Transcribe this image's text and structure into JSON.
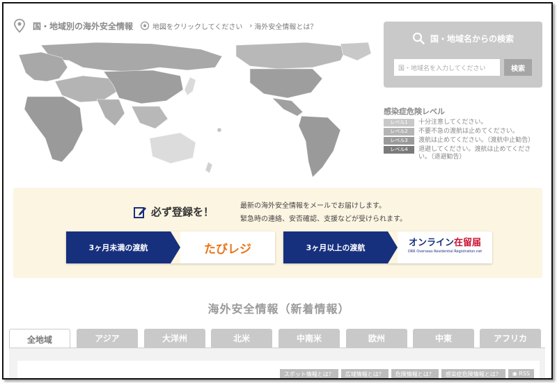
{
  "header": {
    "title": "国・地域別の海外安全情報",
    "hint": "地図をクリックしてください",
    "about_link": "海外安全情報とは？"
  },
  "search": {
    "title": "国・地域名からの検索",
    "placeholder": "国・地域名を入力してください",
    "button": "検索"
  },
  "legend": {
    "title": "感染症危険レベル",
    "levels": [
      {
        "badge": "レベル1",
        "text": "十分注意してください。",
        "color": "#c8c8c8"
      },
      {
        "badge": "レベル2",
        "text": "不要不急の渡航は止めてください。",
        "color": "#b4b4b4"
      },
      {
        "badge": "レベル3",
        "text": "渡航は止めてください。（渡航中止勧告）",
        "color": "#9a9a9a"
      },
      {
        "badge": "レベル4",
        "text": "退避してください。渡航は止めてください。（退避勧告）",
        "color": "#7a7a7a"
      }
    ]
  },
  "register": {
    "heading": "必ず登録を！",
    "desc_line1": "最新の海外安全情報をメールでお届けします。",
    "desc_line2": "緊急時の連絡、安否確認、支援などが受けられます。",
    "btn_short": "3ヶ月未満の渡航",
    "logo_short": "たびレジ",
    "btn_long": "3ヶ月以上の渡航",
    "logo_long_1": "オンライン",
    "logo_long_2": "在留届",
    "logo_long_sub": "ORR Overseas Residential Registration.net"
  },
  "news": {
    "title": "海外安全情報（新着情報）",
    "tabs": [
      "全地域",
      "アジア",
      "大洋州",
      "北米",
      "中南米",
      "欧州",
      "中東",
      "アフリカ"
    ],
    "links": [
      "スポット情報とは？",
      "広域情報とは？",
      "危険情報とは？",
      "感染症危険情報とは？",
      "RSS"
    ]
  },
  "colors": {
    "brand_navy": "#17307e",
    "panel_gray": "#c9c9c9",
    "register_bg": "#fcf5e2"
  }
}
